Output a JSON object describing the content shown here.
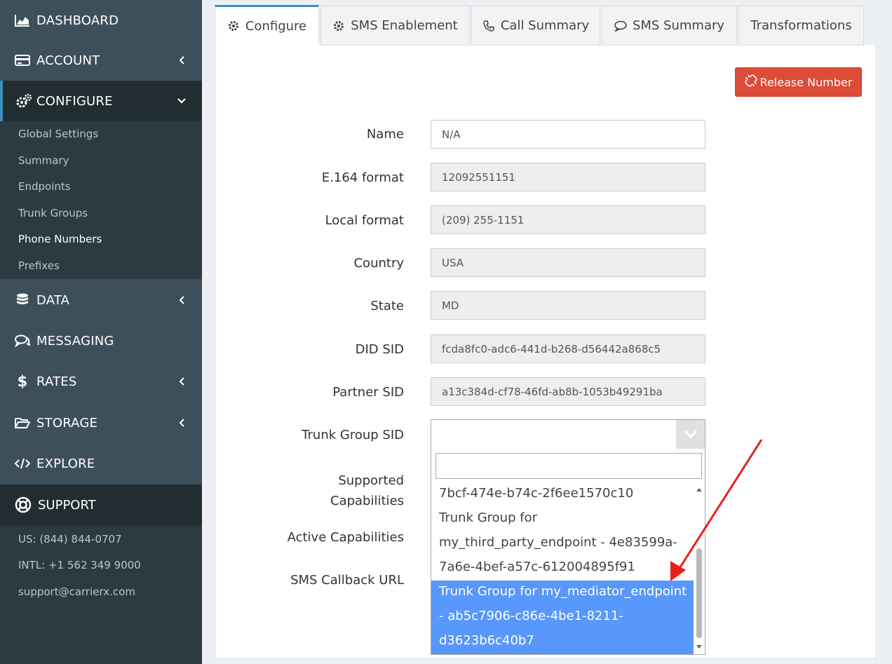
{
  "sidebar": {
    "nav": [
      {
        "label": "DASHBOARD",
        "icon": "chart-area-icon",
        "chevron": ""
      },
      {
        "label": "ACCOUNT",
        "icon": "credit-card-icon",
        "chevron": "left"
      },
      {
        "label": "CONFIGURE",
        "icon": "cogs-icon",
        "chevron": "down"
      },
      {
        "label": "DATA",
        "icon": "database-icon",
        "chevron": "left"
      },
      {
        "label": "MESSAGING",
        "icon": "comments-icon",
        "chevron": ""
      },
      {
        "label": "RATES",
        "icon": "dollar-icon",
        "chevron": "left"
      },
      {
        "label": "STORAGE",
        "icon": "folder-open-icon",
        "chevron": "left"
      },
      {
        "label": "EXPLORE",
        "icon": "code-icon",
        "chevron": ""
      }
    ],
    "configure_items": [
      "Global Settings",
      "Summary",
      "Endpoints",
      "Trunk Groups",
      "Phone Numbers",
      "Prefixes"
    ],
    "current_item": "Phone Numbers",
    "support": {
      "label": "SUPPORT",
      "icon": "life-ring-icon",
      "us": "US: (844) 844-0707",
      "intl": "INTL: +1 562 349 9000",
      "email": "support@carrierx.com"
    }
  },
  "tabs": [
    {
      "label": "Configure",
      "icon": "gear-icon"
    },
    {
      "label": "SMS Enablement",
      "icon": "gear-icon"
    },
    {
      "label": "Call Summary",
      "icon": "phone-icon"
    },
    {
      "label": "SMS Summary",
      "icon": "comment-icon"
    },
    {
      "label": "Transformations",
      "icon": ""
    }
  ],
  "release_button": {
    "label": "Release Number",
    "icon": "unlink-icon"
  },
  "form": {
    "name": {
      "label": "Name",
      "value": "N/A"
    },
    "e164": {
      "label": "E.164 format",
      "value": "12092551151"
    },
    "local": {
      "label": "Local format",
      "value": "(209) 255-1151"
    },
    "country": {
      "label": "Country",
      "value": "USA"
    },
    "state": {
      "label": "State",
      "value": "MD"
    },
    "did_sid": {
      "label": "DID SID",
      "value": "fcda8fc0-adc6-441d-b268-d56442a868c5"
    },
    "partner_sid": {
      "label": "Partner SID",
      "value": "a13c384d-cf78-46fd-ab8b-1053b49291ba"
    },
    "trunk_group_sid": {
      "label": "Trunk Group SID",
      "value": ""
    },
    "supported_capabilities": {
      "label_line1": "Supported",
      "label_line2": "Capabilities"
    },
    "active_capabilities": {
      "label": "Active Capabilities"
    },
    "sms_callback_url": {
      "label": "SMS Callback URL"
    }
  },
  "dropdown": {
    "search_value": "",
    "options": [
      {
        "lines": [
          "7bcf-474e-b74c-2f6ee1570c10"
        ],
        "selected": false
      },
      {
        "lines": [
          "Trunk Group for",
          "my_third_party_endpoint - 4e83599a-",
          "7a6e-4bef-a57c-612004895f91"
        ],
        "selected": false
      },
      {
        "lines": [
          "Trunk Group for my_mediator_endpoint",
          "- ab5c7906-c86e-4be1-8211-",
          "d3623b6c40b7"
        ],
        "selected": true
      }
    ]
  },
  "colors": {
    "sidebar_bg": "#3e4f5c",
    "sidebar_active": "#222d32",
    "accent": "#3c8dbc",
    "danger": "#dd4b39",
    "selected_option": "#5897fb",
    "annotation_arrow": "#e8201a"
  }
}
